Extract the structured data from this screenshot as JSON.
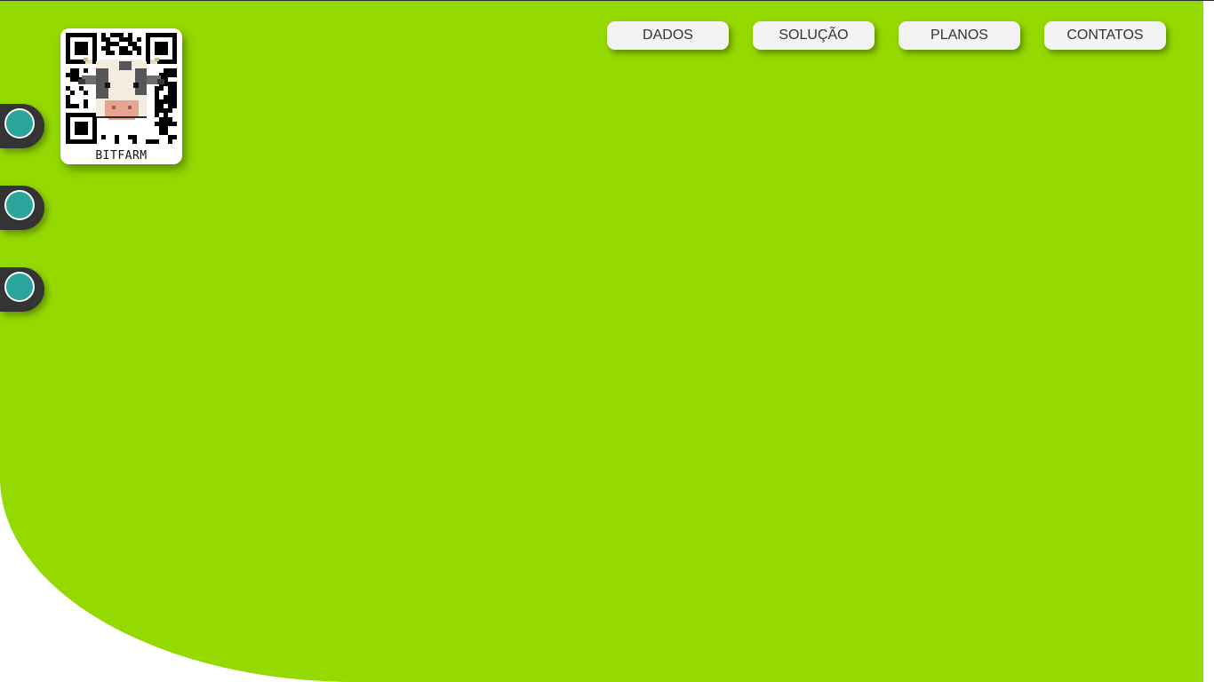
{
  "theme": {
    "hero_color": "#94d900",
    "toggle_color": "#2aa59b",
    "tab_color": "#343434"
  },
  "logo": {
    "text": "BITFARM",
    "icon": "qr-cow-logo"
  },
  "nav": {
    "items": [
      {
        "label": "DADOS"
      },
      {
        "label": "SOLUÇÃO"
      },
      {
        "label": "PLANOS"
      },
      {
        "label": "CONTATOS"
      }
    ]
  },
  "side_toggles": [
    {
      "icon": "circle-toggle-icon"
    },
    {
      "icon": "circle-toggle-icon"
    },
    {
      "icon": "circle-toggle-icon"
    }
  ]
}
